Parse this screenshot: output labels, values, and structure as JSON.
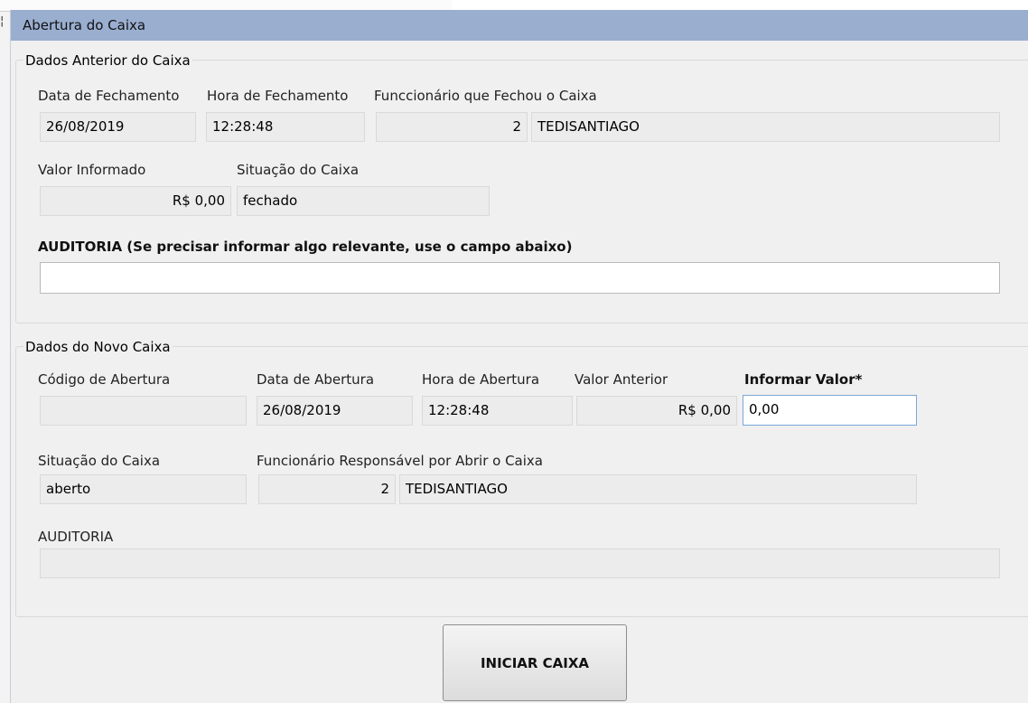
{
  "window": {
    "title": "Abertura do Caixa"
  },
  "previous": {
    "legend": "Dados Anterior do Caixa",
    "labels": {
      "closing_date": "Data de Fechamento",
      "closing_time": "Hora de Fechamento",
      "closed_by": "Funccionário que Fechou o Caixa",
      "informed_value": "Valor Informado",
      "status": "Situação do Caixa",
      "audit": "AUDITORIA (Se precisar informar algo relevante, use o campo abaixo)"
    },
    "values": {
      "closing_date": "26/08/2019",
      "closing_time": "12:28:48",
      "employee_code": "2",
      "employee_name": "TEDISANTIAGO",
      "informed_value": "R$ 0,00",
      "status": "fechado",
      "audit": ""
    }
  },
  "new_box": {
    "legend": "Dados do Novo Caixa",
    "labels": {
      "opening_code": "Código de Abertura",
      "opening_date": "Data de Abertura",
      "opening_time": "Hora de Abertura",
      "previous_value": "Valor Anterior",
      "inform_value": "Informar Valor*",
      "status": "Situação do Caixa",
      "responsible": "Funcionário Responsável por Abrir o Caixa",
      "audit": "AUDITORIA"
    },
    "values": {
      "opening_code": "",
      "opening_date": "26/08/2019",
      "opening_time": "12:28:48",
      "previous_value": "R$ 0,00",
      "inform_value": "0,00",
      "status": "aberto",
      "employee_code": "2",
      "employee_name": "TEDISANTIAGO",
      "audit": ""
    }
  },
  "actions": {
    "start_label": "INICIAR CAIXA"
  },
  "colors": {
    "titlebar": "#9aaed0",
    "window_bg": "#f0f0f0",
    "field_bg": "#ececec",
    "focus_border": "#7aa7d8"
  }
}
